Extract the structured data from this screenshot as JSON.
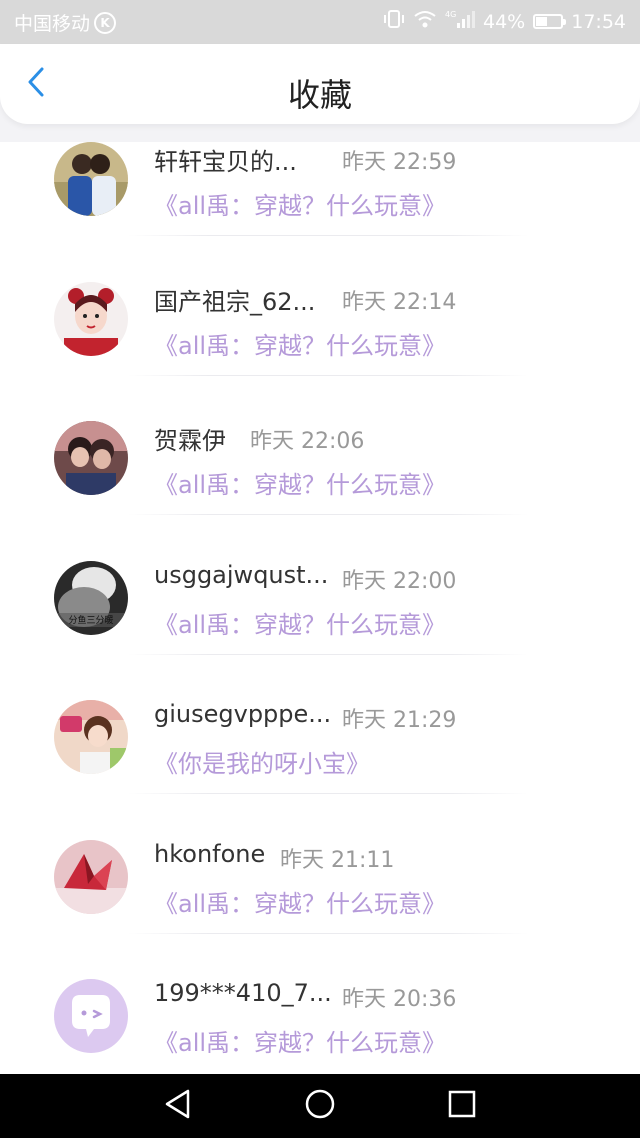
{
  "status_bar": {
    "carrier": "中国移动",
    "carrier_badge": "K",
    "network": "4G",
    "battery_percent": "44%",
    "battery_level": 0.44,
    "time": "17:54"
  },
  "header": {
    "title": "收藏",
    "back_icon": "chevron-left-icon",
    "accent_color": "#2b8fe6"
  },
  "list": {
    "title_color": "#b59ad9",
    "items": [
      {
        "name": "轩轩宝贝的...",
        "time": "昨天 22:59",
        "title": "《all禹：穿越？什么玩意》"
      },
      {
        "name": "国产祖宗_62...",
        "time": "昨天 22:14",
        "title": "《all禹：穿越？什么玩意》"
      },
      {
        "name": "贺霖伊",
        "time": "昨天 22:06",
        "title": "《all禹：穿越？什么玩意》"
      },
      {
        "name": "usggajwqust...",
        "time": "昨天 22:00",
        "title": "《all禹：穿越？什么玩意》"
      },
      {
        "name": "giusegvpppe...",
        "time": "昨天 21:29",
        "title": "《你是我的呀小宝》"
      },
      {
        "name": "hkonfone",
        "time": "昨天 21:11",
        "title": "《all禹：穿越？什么玩意》"
      },
      {
        "name": "199***410_7...",
        "time": "昨天 20:36",
        "title": "《all禹：穿越？什么玩意》"
      }
    ]
  },
  "avatar_text": {
    "item_4": "分鱼三分暖"
  },
  "nav_bar": {
    "back": "triangle-back-icon",
    "home": "circle-home-icon",
    "recent": "square-recent-icon"
  }
}
